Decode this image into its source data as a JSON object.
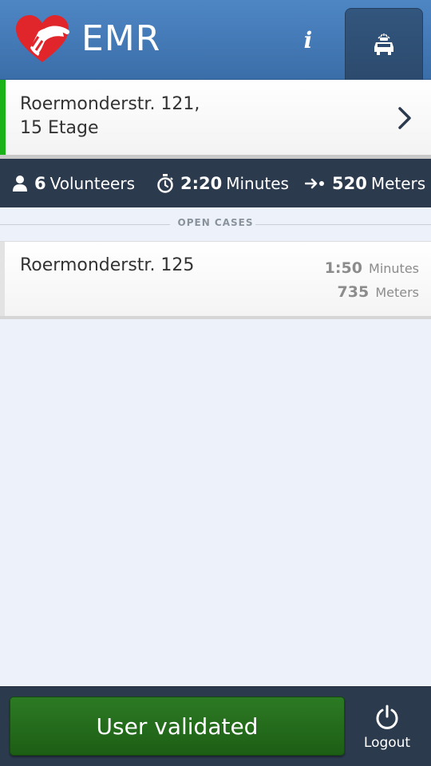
{
  "header": {
    "title": "EMR",
    "info_label": "i",
    "logo_icon": "heart-hand-logo",
    "tab_icon": "ambulance-icon"
  },
  "active_case": {
    "address_line1": "Roermonderstr. 121,",
    "address_line2": "15 Etage",
    "status_color": "#19b319"
  },
  "stats": {
    "volunteers_value": "6",
    "volunteers_label": "Volunteers",
    "time_value": "2:20",
    "time_label": "Minutes",
    "distance_value": "520",
    "distance_label": "Meters"
  },
  "open_cases": {
    "section_label": "OPEN CASES",
    "items": [
      {
        "address": "Roermonderstr. 125",
        "time_value": "1:50",
        "time_label": "Minutes",
        "distance_value": "735",
        "distance_label": "Meters"
      }
    ]
  },
  "footer": {
    "validated_label": "User validated",
    "logout_label": "Logout"
  },
  "colors": {
    "header": "#4178b8",
    "dark_bar": "#2c3a4e",
    "validated": "#246b1c",
    "background": "#edf2fa"
  }
}
